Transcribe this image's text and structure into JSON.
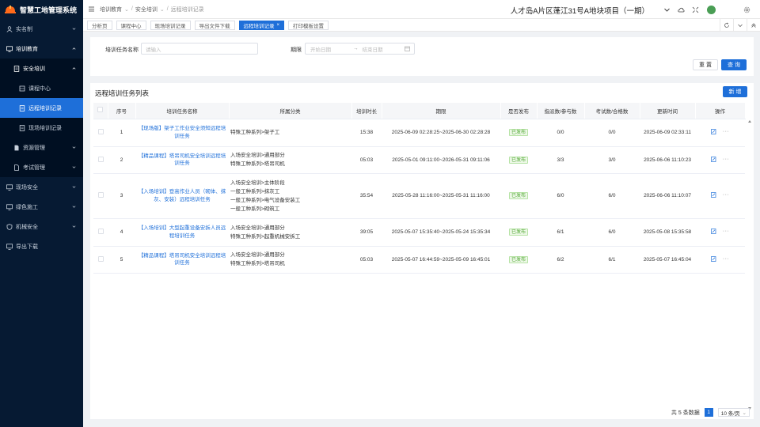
{
  "app": {
    "title": "智慧工地管理系统",
    "project": "人才岛A片区蓬江31号A地块项目（一期）"
  },
  "sidebar": {
    "items": [
      {
        "label": "实名制",
        "icon": "person-icon"
      },
      {
        "label": "培训教育",
        "icon": "monitor-icon"
      },
      {
        "label": "安全培训",
        "icon": "doc-icon"
      },
      {
        "label": "课程中心",
        "icon": "grid-icon"
      },
      {
        "label": "远程培训记录",
        "icon": "doc-icon"
      },
      {
        "label": "现场培训记录",
        "icon": "doc-icon"
      },
      {
        "label": "资源管理",
        "icon": "file-icon"
      },
      {
        "label": "考试管理",
        "icon": "file-icon"
      },
      {
        "label": "现场安全",
        "icon": "monitor-icon"
      },
      {
        "label": "绿色施工",
        "icon": "monitor-icon"
      },
      {
        "label": "机械安全",
        "icon": "shield-icon"
      },
      {
        "label": "导出下载",
        "icon": "monitor-icon"
      }
    ]
  },
  "breadcrumb": [
    "培训教育",
    "安全培训",
    "远程培训记录"
  ],
  "tabs": [
    "分析页",
    "课程中心",
    "现场培训记录",
    "导出文件下载",
    "远程培训记录",
    "打印模板设置"
  ],
  "search": {
    "task_name_label": "培训任务名称",
    "task_name_placeholder": "请输入",
    "period_label": "期限",
    "start_placeholder": "开始日期",
    "end_placeholder": "结束日期",
    "reset_label": "重 置",
    "query_label": "查 询"
  },
  "table": {
    "title": "远程培训任务列表",
    "add_label": "新 增",
    "columns": [
      "序号",
      "培训任务名称",
      "所属分类",
      "培训时长",
      "期限",
      "是否发布",
      "指派数/参与数",
      "考试数/合格数",
      "更新时间",
      "操作"
    ],
    "rows": [
      {
        "no": "1",
        "name": "【现场版】架子工作业安全须知远程培训任务",
        "categories": [
          "特殊工种系列>架子工"
        ],
        "duration": "15:38",
        "period": "2025-06-09 02:28:25~2025-06-30 02:28:28",
        "status": "已发布",
        "assign": "0/0",
        "exam": "0/0",
        "updated": "2025-06-09 02:33:11"
      },
      {
        "no": "2",
        "name": "【精品课程】塔吊司机安全培训远程培训任务",
        "categories": [
          "入场安全培训>通用部分",
          "特殊工种系列>塔吊司机"
        ],
        "duration": "05:03",
        "period": "2025-05-01 09:11:00~2026-05-31 09:11:06",
        "status": "已发布",
        "assign": "3/3",
        "exam": "3/0",
        "updated": "2025-06-06 11:10:23"
      },
      {
        "no": "3",
        "name": "【入场培训】登高作业人员（砌体、抹灰、安装）远程培训任务",
        "categories": [
          "入场安全培训>主体阶段",
          "一般工种系列>抹灰工",
          "一般工种系列>电气设备安装工",
          "一般工种系列>砌筑工"
        ],
        "duration": "35:54",
        "period": "2025-05-28 11:16:00~2025-05-31 11:16:00",
        "status": "已发布",
        "assign": "6/0",
        "exam": "6/0",
        "updated": "2025-06-06 11:10:07"
      },
      {
        "no": "4",
        "name": "【入场培训】大型起重设备安拆人员远程培训任务",
        "categories": [
          "入场安全培训>通用部分",
          "特殊工种系列>起重机械安拆工"
        ],
        "duration": "39:05",
        "period": "2025-05-07 15:35:40~2025-05-24 15:35:34",
        "status": "已发布",
        "assign": "6/1",
        "exam": "6/0",
        "updated": "2025-05-08 15:35:58"
      },
      {
        "no": "5",
        "name": "【精品课程】塔吊司机安全培训远程培训任务",
        "categories": [
          "入场安全培训>通用部分",
          "特殊工种系列>塔吊司机"
        ],
        "duration": "05:03",
        "period": "2025-05-07 16:44:59~2025-05-09 16:45:01",
        "status": "已发布",
        "assign": "6/2",
        "exam": "6/1",
        "updated": "2025-05-07 16:45:04"
      }
    ]
  },
  "pagination": {
    "total_text": "共 5 条数据",
    "current_page": "1",
    "page_size": "10 条/页"
  },
  "colors": {
    "primary": "#1e6fd9",
    "sidebar_bg": "#061a33",
    "success": "#52a836"
  }
}
